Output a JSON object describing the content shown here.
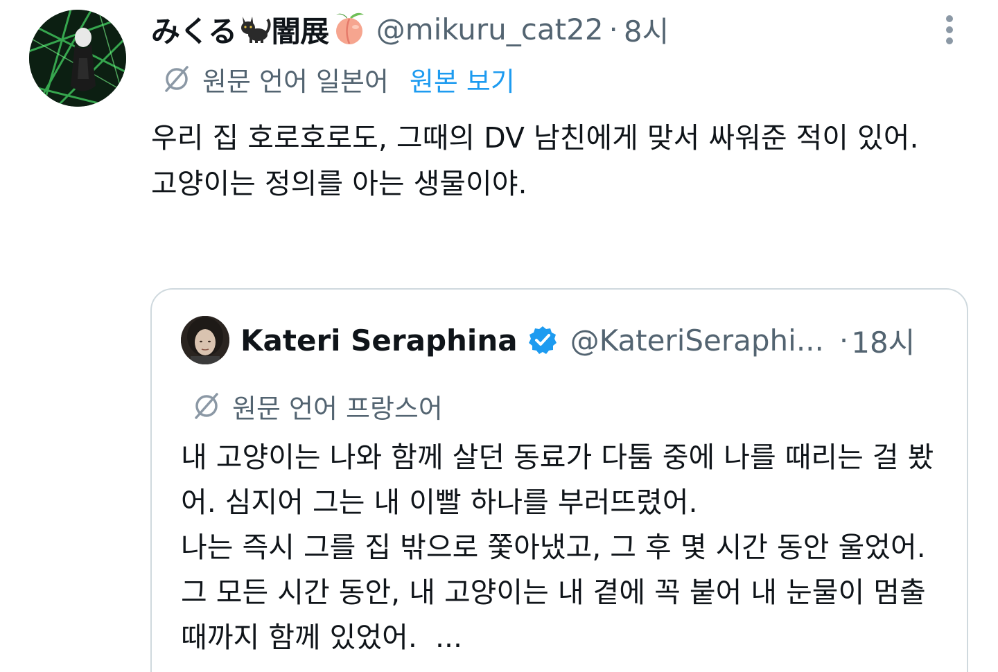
{
  "tweet": {
    "display_name": "みくる",
    "display_name_suffix": "闇展",
    "name_emojis": [
      "black-cat-emoji",
      "peach-emoji"
    ],
    "handle": "@mikuru_cat22",
    "separator": "·",
    "time": "8시",
    "translation": {
      "notice": "원문 언어 일본어",
      "show_original": "원본 보기"
    },
    "body": [
      "우리 집 호로호로도, 그때의 DV 남친에게 맞서 싸워준 적이 있어.",
      "고양이는 정의를 아는 생물이야."
    ]
  },
  "quote": {
    "display_name": "Kateri Seraphina",
    "verified": true,
    "handle": "@KateriSeraphi...",
    "separator": "·",
    "time": "18시",
    "translation": {
      "notice": "원문 언어 프랑스어"
    },
    "body": [
      "내 고양이는 나와 함께 살던 동료가 다툼 중에 나를 때리는 걸 봤어. 심지어 그는 내 이빨 하나를 부러뜨렸어.",
      "나는 즉시 그를 집 밖으로 쫓아냈고, 그 후 몇 시간 동안 울었어. 그 모든 시간 동안, 내 고양이는 내 곁에 꼭 붙어 내 눈물이 멈출 때까지 함께 있었어.",
      "..."
    ]
  },
  "icons": {
    "more": "more-vertical-icon",
    "translate": "translate-icon",
    "verified": "verified-badge-icon"
  },
  "colors": {
    "text_primary": "#0f1419",
    "text_secondary": "#536471",
    "link": "#1d9bf0",
    "verified": "#1d9bf0",
    "card_border": "#cfd9de"
  }
}
